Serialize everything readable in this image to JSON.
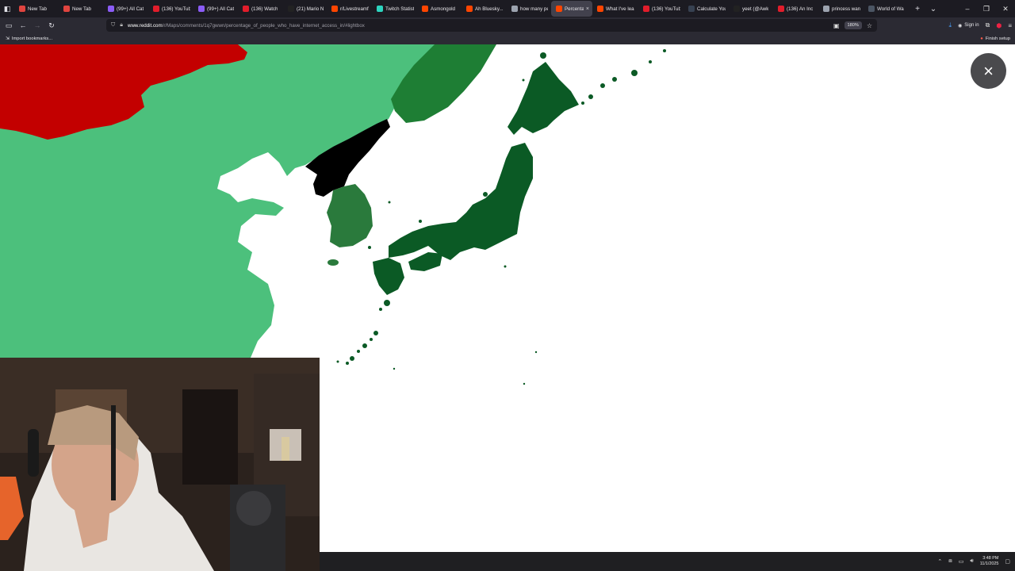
{
  "tabs": [
    {
      "label": "New Tab",
      "favicon_color": "#e0443f"
    },
    {
      "label": "New Tab",
      "favicon_color": "#e0443f"
    },
    {
      "label": "(99+) All Cat",
      "favicon_color": "#8b5cf6"
    },
    {
      "label": "(136) YouTub",
      "favicon_color": "#e11d2b"
    },
    {
      "label": "(99+) All Cat",
      "favicon_color": "#8b5cf6"
    },
    {
      "label": "(136) Watch",
      "favicon_color": "#e11d2b"
    },
    {
      "label": "(21) Mario N",
      "favicon_color": "#222222"
    },
    {
      "label": "r/Livestreamf",
      "favicon_color": "#ff4500"
    },
    {
      "label": "Twitch Statisti",
      "favicon_color": "#2dd4bf"
    },
    {
      "label": "Asmongold",
      "favicon_color": "#ff4500"
    },
    {
      "label": "Ah Bluesky...",
      "favicon_color": "#ff4500"
    },
    {
      "label": "how many pe",
      "favicon_color": "#9ca3af"
    },
    {
      "label": "Percentag",
      "favicon_color": "#ff4500",
      "active": true
    },
    {
      "label": "What I've lea",
      "favicon_color": "#ff4500"
    },
    {
      "label": "(136) YouTub",
      "favicon_color": "#e11d2b"
    },
    {
      "label": "Calculate You",
      "favicon_color": "#374151"
    },
    {
      "label": "yeet (@Awk",
      "favicon_color": "#222222"
    },
    {
      "label": "(136) An Inc",
      "favicon_color": "#e11d2b"
    },
    {
      "label": "princess wan",
      "favicon_color": "#9ca3af"
    },
    {
      "label": "World of Wa",
      "favicon_color": "#4b5563"
    }
  ],
  "tab_close_glyph": "×",
  "new_tab_glyph": "+",
  "tab_list_glyph": "⌄",
  "window": {
    "minimize": "–",
    "restore": "❐",
    "close": "✕"
  },
  "url": {
    "domain": "www.reddit.com",
    "path": "/r/Maps/comments/1q7gwwn/percentage_of_people_who_have_internet_access_in/#lightbox"
  },
  "zoom_level": "180%",
  "sign_in_label": "Sign in",
  "bookmarks": {
    "import_label": "Import bookmarks...",
    "finish_setup_label": "Finish setup"
  },
  "lightbox_close_glyph": "×",
  "taskbar": {
    "time": "3:48 PM",
    "date": "11/1/2025"
  },
  "map_colors": {
    "ocean": "#ffffff",
    "china": "#4cc07c",
    "russia": "#c30000",
    "north_korea": "#000000",
    "south_korea": "#2a7a3c",
    "japan": "#0b5a25",
    "taiwan": "#2a7a3c"
  }
}
